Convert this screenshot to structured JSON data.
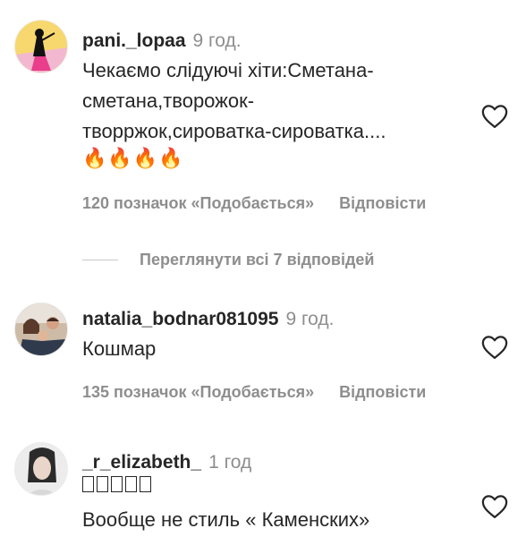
{
  "comments": [
    {
      "username": "pani._lopaa",
      "time": "9 год.",
      "lines": [
        "Чекаємо слідуючі хіти:Сметана-",
        "сметана,творожок-",
        "творржок,сироватка-сироватка...."
      ],
      "emoji": "🔥🔥🔥🔥",
      "likes": "120 позначок «Подобається»",
      "reply": "Відповісти"
    },
    {
      "username": "natalia_bodnar081095",
      "time": "9 год.",
      "lines": [
        "Кошмар"
      ],
      "likes": "135 позначок «Подобається»",
      "reply": "Відповісти"
    },
    {
      "username": "_r_elizabeth_",
      "time": "1 год",
      "lines": [
        "Вообще не стиль « Каменских»"
      ]
    }
  ],
  "view_replies": "Переглянути всі 7 відповідей",
  "icons": {
    "like": "heart-outline-icon",
    "unsupported_glyphs": "missing-glyph-boxes"
  },
  "colors": {
    "text": "#262626",
    "secondary": "#8e8e8e",
    "avatar1_bg": "#f6d56b",
    "avatar1_accent": "#e83e8c"
  }
}
